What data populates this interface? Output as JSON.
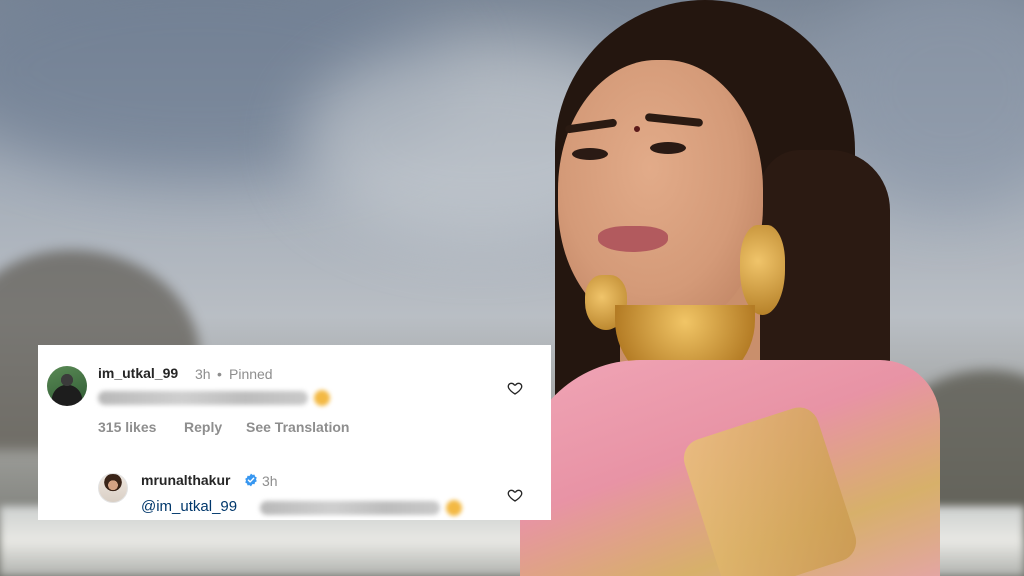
{
  "comment_thread": {
    "comment": {
      "username": "im_utkal_99",
      "time": "3h",
      "separator": "•",
      "pinned_label": "Pinned",
      "likes": "315 likes",
      "reply_label": "Reply",
      "translate_label": "See Translation"
    },
    "reply": {
      "username": "mrunalthakur",
      "time": "3h",
      "mention": "@im_utkal_99"
    }
  },
  "icons": {
    "heart": "heart-outline-icon",
    "verified": "verified-badge-icon"
  },
  "colors": {
    "verified_blue": "#3897f0",
    "mention_blue": "#00376b",
    "meta_gray": "#8e8e8e"
  }
}
